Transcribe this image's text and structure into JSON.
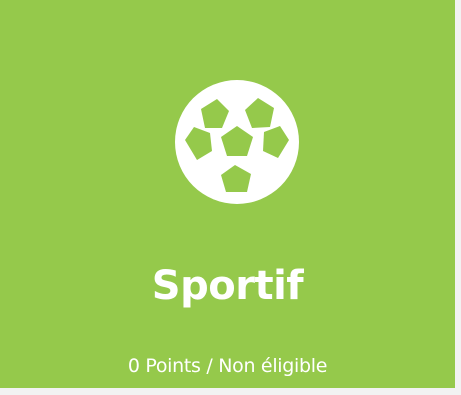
{
  "card": {
    "icon": "soccer-ball-icon",
    "title": "Sportif",
    "status": "0 Points / Non éligible",
    "background_color": "#95c94b",
    "text_color": "#ffffff"
  }
}
